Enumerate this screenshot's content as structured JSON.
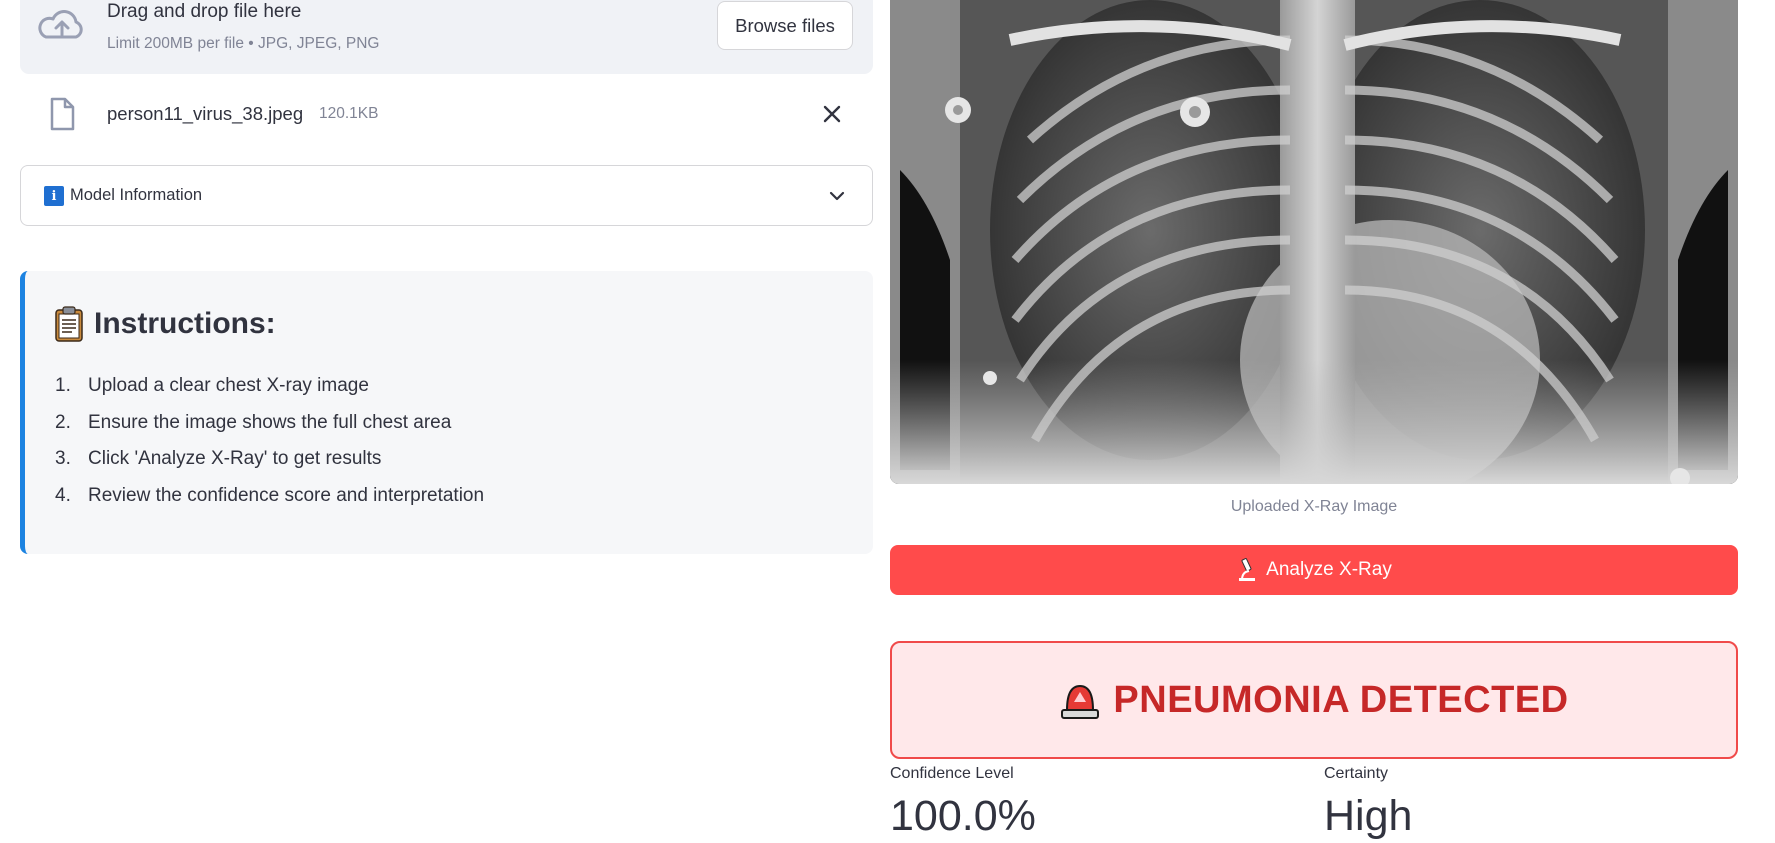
{
  "uploader": {
    "title": "Drag and drop file here",
    "subtitle": "Limit 200MB per file • JPG, JPEG, PNG",
    "browse_label": "Browse files",
    "icon": "cloud-upload-icon"
  },
  "uploaded_file": {
    "name": "person11_virus_38.jpeg",
    "size": "120.1KB",
    "icon": "file-icon"
  },
  "expander": {
    "label": "Model Information",
    "badge": "i"
  },
  "instructions": {
    "title": "Instructions:",
    "items": [
      {
        "num": "1.",
        "text": "Upload a clear chest X-ray image"
      },
      {
        "num": "2.",
        "text": "Ensure the image shows the full chest area"
      },
      {
        "num": "3.",
        "text": "Click 'Analyze X-Ray' to get results"
      },
      {
        "num": "4.",
        "text": "Review the confidence score and interpretation"
      }
    ]
  },
  "image": {
    "caption": "Uploaded X-Ray Image"
  },
  "analyze_button": {
    "label": "Analyze X-Ray"
  },
  "result": {
    "text": "PNEUMONIA DETECTED"
  },
  "metrics": {
    "confidence_label": "Confidence Level",
    "confidence_value": "100.0%",
    "certainty_label": "Certainty",
    "certainty_value": "High"
  },
  "colors": {
    "primary_button": "#ff4b4b",
    "result_bg": "#ffe8ea",
    "result_text": "#c62828",
    "info_accent": "#1c83e1"
  }
}
